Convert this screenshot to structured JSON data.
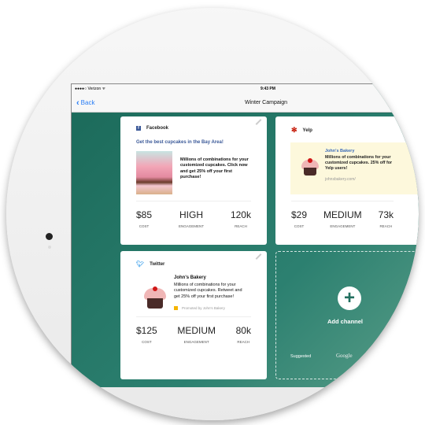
{
  "status": {
    "carrier": "●●●●○ Verizon ᯤ",
    "time": "9:43 PM"
  },
  "nav": {
    "back": "Back",
    "title": "Winter Campaign"
  },
  "cards": {
    "facebook": {
      "name": "Facebook",
      "headline": "Get the best cupcakes in the Bay Area!",
      "body": "Millions of combinations for your customized cupcakes. Click now and get 25% off your first purchase!",
      "cost": "$85",
      "engagement": "HIGH",
      "reach": "120k"
    },
    "yelp": {
      "name": "Yelp",
      "business": "John's Bakery",
      "body": "Millions of combinations for your customized cupcakes. 25% off for Yelp users!",
      "url": "johnsbakery.com/",
      "cost": "$29",
      "engagement": "MEDIUM",
      "reach": "73k"
    },
    "twitter": {
      "name": "Twitter",
      "business": "John's Bakery",
      "body": "Millions of combinations for your customized cupcakes. Retweet and get 25% off your first purchase!",
      "promoted": "Promoted by John's Bakery",
      "cost": "$125",
      "engagement": "MEDIUM",
      "reach": "80k"
    }
  },
  "labels": {
    "cost": "COST",
    "engagement": "ENGAGEMENT",
    "reach": "REACH"
  },
  "add": {
    "label": "Add channel",
    "suggested": "Suggested",
    "suggestion": "Google"
  }
}
